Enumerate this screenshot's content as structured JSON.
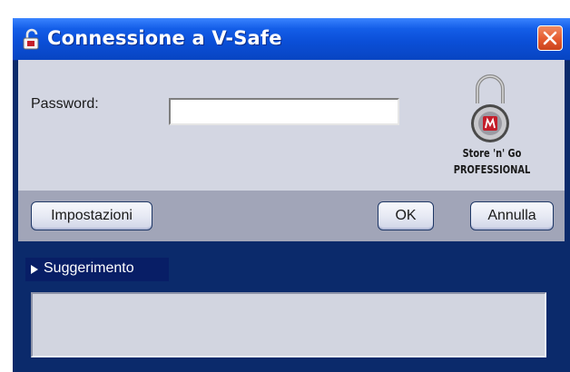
{
  "window": {
    "title": "Connessione a V-Safe"
  },
  "form": {
    "password_label": "Password:",
    "password_value": ""
  },
  "brand": {
    "line1": "Store 'n' Go",
    "line2": "PROFESSIONAL",
    "badge_color": "#c41e2a"
  },
  "buttons": {
    "settings_label": "Impostazioni",
    "ok_label": "OK",
    "cancel_label": "Annulla"
  },
  "hint": {
    "header_label": "Suggerimento",
    "text": ""
  },
  "icons": {
    "title": "lock-app-icon",
    "close": "close-icon",
    "logo": "padlock-logo-icon",
    "hint_toggle": "triangle-right-icon"
  },
  "colors": {
    "titlebar": "#0b4fd8",
    "panel": "#d3d6e2",
    "button_bar": "#a1a5b8",
    "window_frame": "#0b2a6b",
    "close_button": "#e55a2e"
  }
}
